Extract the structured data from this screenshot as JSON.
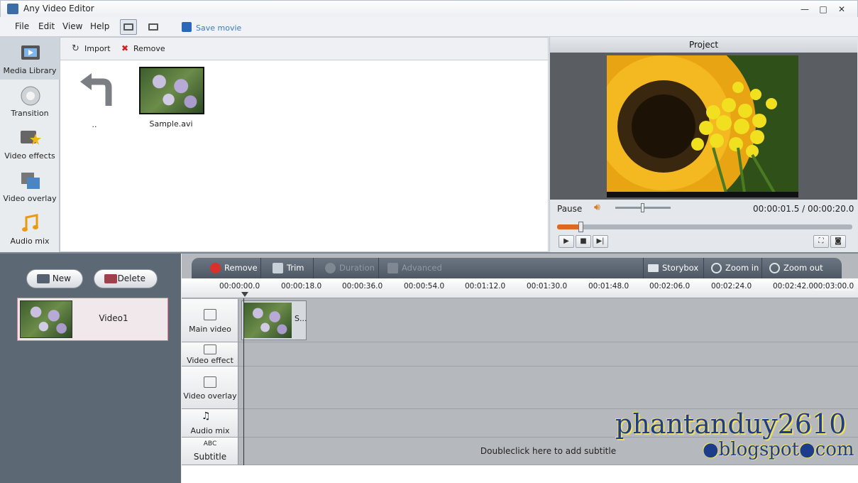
{
  "window": {
    "title": "Any Video Editor",
    "min": "—",
    "max": "□",
    "close": "✕"
  },
  "menu": {
    "items": [
      "File",
      "Edit",
      "View",
      "Help"
    ],
    "save_movie": "Save movie"
  },
  "nav": {
    "items": [
      "Media Library",
      "Transition",
      "Video effects",
      "Video overlay",
      "Audio mix"
    ]
  },
  "library": {
    "import": "Import",
    "remove": "Remove",
    "up_label": "..",
    "file_label": "Sample.avi"
  },
  "preview": {
    "header": "Project",
    "state": "Pause",
    "time": "00:00:01.5 / 00:00:20.0",
    "volume_fraction": 0.5,
    "progress_fraction": 0.08
  },
  "project": {
    "new": "New",
    "delete": "Delete",
    "item_label": "Video1"
  },
  "timeline": {
    "toolbar": {
      "remove": "Remove",
      "trim": "Trim",
      "duration": "Duration",
      "advanced": "Advanced",
      "storybox": "Storybox",
      "zoom_in": "Zoom in",
      "zoom_out": "Zoom out"
    },
    "ticks": [
      "00:00:00.0",
      "00:00:18.0",
      "00:00:36.0",
      "00:00:54.0",
      "00:01:12.0",
      "00:01:30.0",
      "00:01:48.0",
      "00:02:06.0",
      "00:02:24.0",
      "00:02:42.0",
      "00:03:00.0"
    ],
    "tracks": {
      "main": "Main video",
      "effect": "Video effect",
      "overlay": "Video overlay",
      "audio": "Audio mix",
      "subtitle_abc": "ABC",
      "subtitle": "Subtitle"
    },
    "clip_label": "S...",
    "subtitle_hint": "Doubleclick here to add subtitle"
  },
  "watermark": {
    "line1": "phantanduy2610",
    "line2": "●blogspot●com"
  },
  "colors": {
    "accent": "#e0671d",
    "link": "#3c7bc7",
    "project_item_border": "#e07c8f"
  }
}
